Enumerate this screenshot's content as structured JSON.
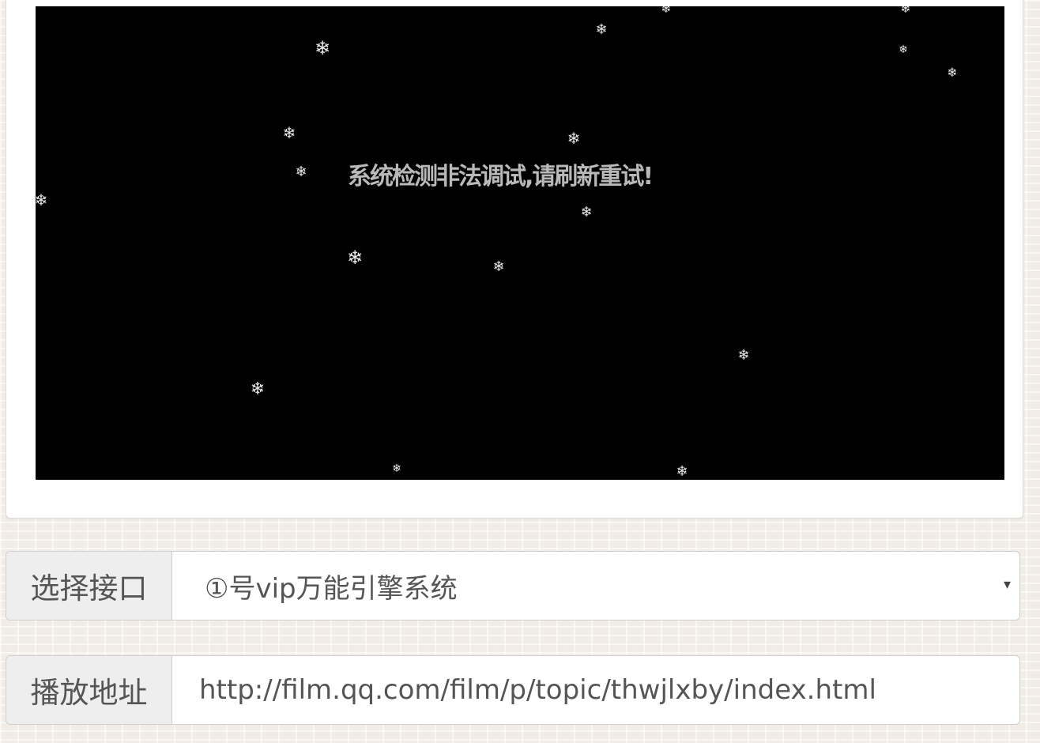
{
  "player": {
    "message": "系统检测非法调试,请刷新重试!",
    "snowflake_glyph": "❄",
    "background": "#000000"
  },
  "api_select": {
    "label": "选择接口",
    "selected": "①号vip万能引擎系统",
    "caret_icon": "▾"
  },
  "play_url": {
    "label": "播放地址",
    "value": "http://film.qq.com/film/p/topic/thwjlxby/index.html"
  }
}
